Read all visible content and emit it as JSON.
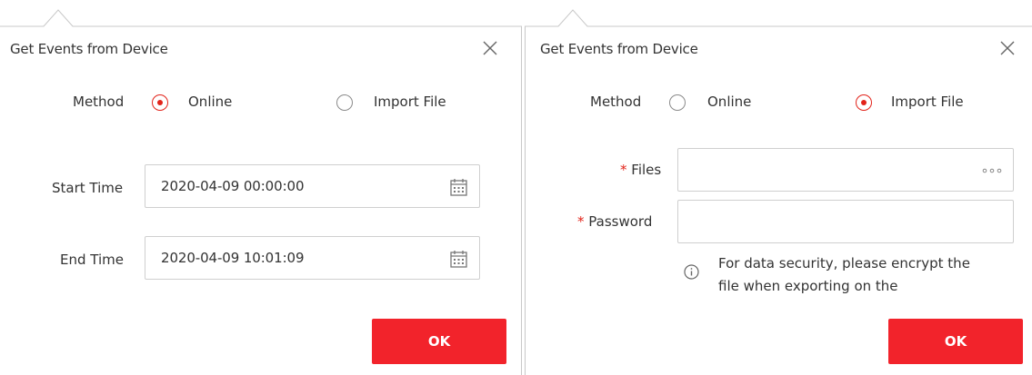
{
  "dialogs": [
    {
      "title": "Get Events from Device",
      "method": {
        "label": "Method",
        "options": [
          {
            "label": "Online",
            "selected": true
          },
          {
            "label": "Import File",
            "selected": false
          }
        ]
      },
      "start_time": {
        "label": "Start Time",
        "value": "2020-04-09 00:00:00"
      },
      "end_time": {
        "label": "End Time",
        "value": "2020-04-09 10:01:09"
      },
      "ok_label": "OK",
      "icons": [
        "close-icon",
        "radio-checked-icon",
        "radio-unchecked-icon",
        "calendar-icon"
      ]
    },
    {
      "title": "Get Events from Device",
      "method": {
        "label": "Method",
        "options": [
          {
            "label": "Online",
            "selected": false
          },
          {
            "label": "Import File",
            "selected": true
          }
        ]
      },
      "files": {
        "required_mark": "*",
        "label": "Files",
        "value": ""
      },
      "password": {
        "required_mark": "*",
        "label": "Password",
        "value": ""
      },
      "note": "For data security, please encrypt the file when exporting on the",
      "ok_label": "OK",
      "icons": [
        "close-icon",
        "radio-unchecked-icon",
        "radio-checked-icon",
        "more-dots-icon",
        "info-icon"
      ]
    }
  ],
  "colors": {
    "accent": "#f2232b",
    "radio_checked": "#e2231a",
    "border": "#cfcfcf",
    "text": "#333333"
  }
}
